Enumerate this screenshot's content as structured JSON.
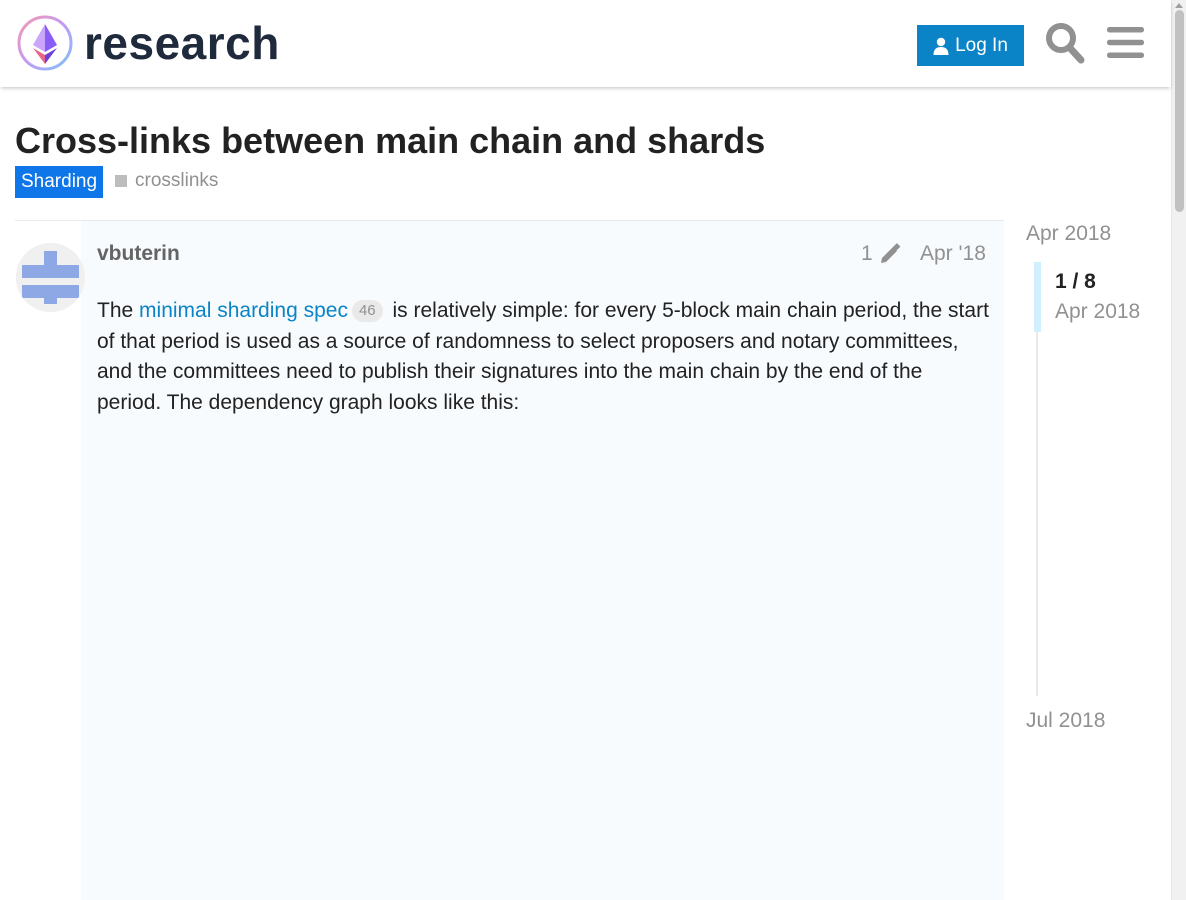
{
  "header": {
    "site_name": "research",
    "login_label": "Log In",
    "search_icon": "search-icon",
    "menu_icon": "hamburger-menu-icon",
    "accent_color": "#0a84c6"
  },
  "topic": {
    "title": "Cross-links between main chain and shards",
    "category": "Sharding",
    "category_color": "#0e76e8",
    "tag": "crosslinks"
  },
  "post": {
    "username": "vbuterin",
    "edit_count": "1",
    "date": "Apr '18",
    "body_intro": "The ",
    "link_text": "minimal sharding spec",
    "link_clicks": "46",
    "body_rest": " is relatively simple: for every 5-block main chain period, the start of that period is used as a source of randomness to select proposers and notary committees, and the committees need to publish their signatures into the main chain by the end of the period. The dependency graph looks like this:"
  },
  "timeline": {
    "start_date": "Apr 2018",
    "position": "1 / 8",
    "position_date": "Apr 2018",
    "end_date": "Jul 2018"
  }
}
